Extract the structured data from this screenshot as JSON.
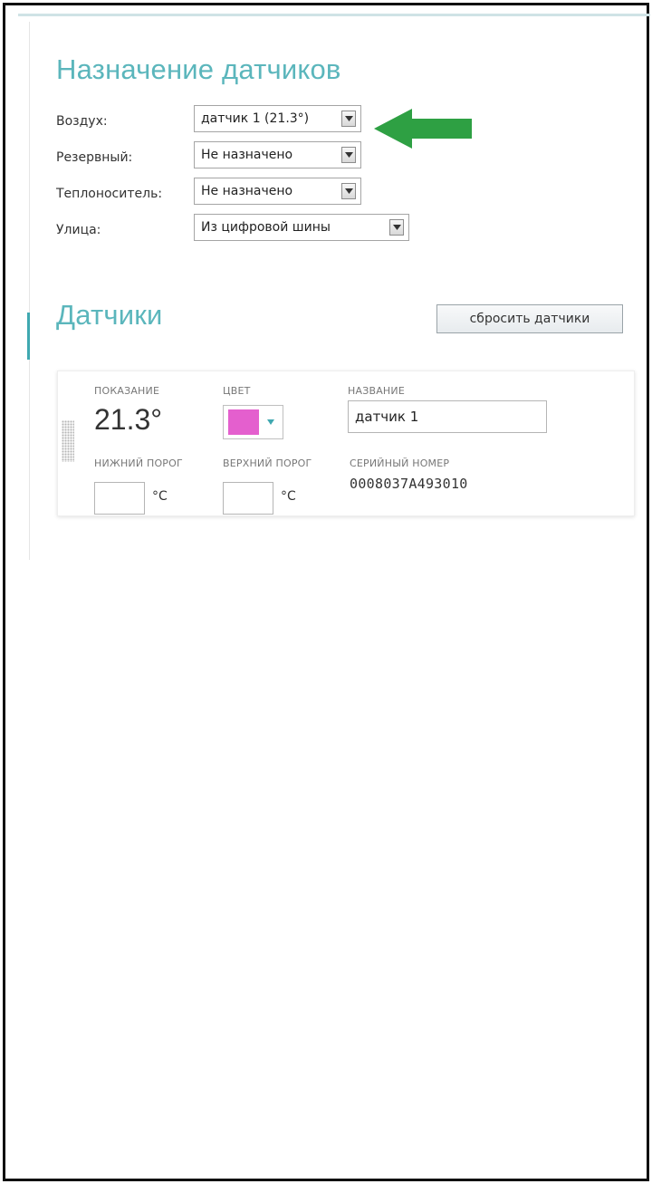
{
  "assignment": {
    "title": "Назначение датчиков",
    "rows": [
      {
        "label": "Воздух:",
        "value": "датчик 1 (21.3°)"
      },
      {
        "label": "Резервный:",
        "value": "Не назначено"
      },
      {
        "label": "Теплоноситель:",
        "value": "Не назначено"
      },
      {
        "label": "Улица:",
        "value": "Из цифровой шины"
      }
    ]
  },
  "sensors": {
    "title": "Датчики",
    "reset_label": "сбросить датчики",
    "card": {
      "reading_label": "ПОКАЗАНИЕ",
      "reading_value": "21.3°",
      "color_label": "ЦВЕТ",
      "color_hex": "#e45fce",
      "name_label": "НАЗВАНИЕ",
      "name_value": "датчик 1",
      "lower_label": "НИЖНИЙ ПОРОГ",
      "upper_label": "ВЕРХНИЙ ПОРОГ",
      "unit": "°C",
      "serial_label": "СЕРИЙНЫЙ НОМЕР",
      "serial_value": "0008037A493010"
    }
  },
  "colors": {
    "accent": "#5bb6bc",
    "green_arrow": "#2ea043"
  },
  "icons": {
    "dropdown": "chevron-down-icon",
    "pointer": "green-arrow-left-icon",
    "drag": "drag-handle-icon"
  }
}
